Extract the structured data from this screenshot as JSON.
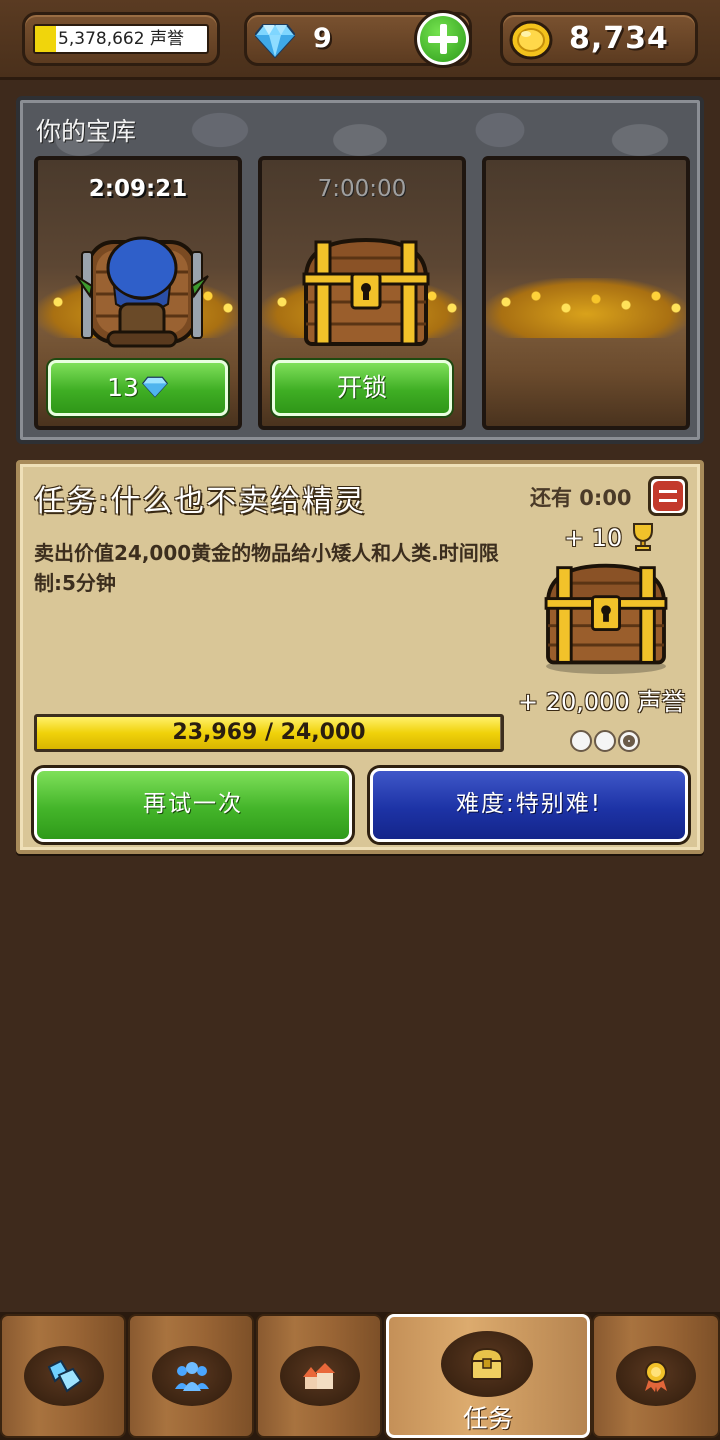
{
  "status_bar": {
    "fame_text": "5,378,662 声誉",
    "fame_progress": 0.12,
    "gems": "9",
    "gold": "8,734"
  },
  "vault": {
    "title": "你的宝库",
    "slots": [
      {
        "timer": "2:09:21",
        "button_label": "13",
        "content": "goblin-trapped-chest"
      },
      {
        "timer": "7:00:00",
        "button_label": "开锁",
        "content": "treasure-chest"
      },
      {
        "timer": "",
        "button_label": "",
        "content": "empty"
      }
    ]
  },
  "quest": {
    "title": "任务:什么也不卖给精灵",
    "time_left": "还有 0:00",
    "description": "卖出价值24,000黄金的物品给小矮人和人类.时间限制:5分钟",
    "reward_trophy": "+ 10",
    "reward_fame": "+ 20,000 声誉",
    "progress_text": "23,969 / 24,000",
    "progress_value": 23969,
    "progress_max": 24000,
    "retry_label": "再试一次",
    "difficulty_label": "难度:特别难!",
    "difficulty_circles": [
      false,
      false,
      true
    ]
  },
  "nav": {
    "tabs": [
      {
        "icon": "gems-icon",
        "label": ""
      },
      {
        "icon": "people-icon",
        "label": ""
      },
      {
        "icon": "town-icon",
        "label": ""
      },
      {
        "icon": "chest-icon",
        "label": "任务",
        "active": true
      },
      {
        "icon": "medal-icon",
        "label": ""
      }
    ]
  },
  "colors": {
    "background": "#3e2a1c",
    "green_button": "#3fae24",
    "blue_button": "#1d33a6",
    "progress_yellow": "#f0d20a",
    "parchment": "#d9c697"
  }
}
